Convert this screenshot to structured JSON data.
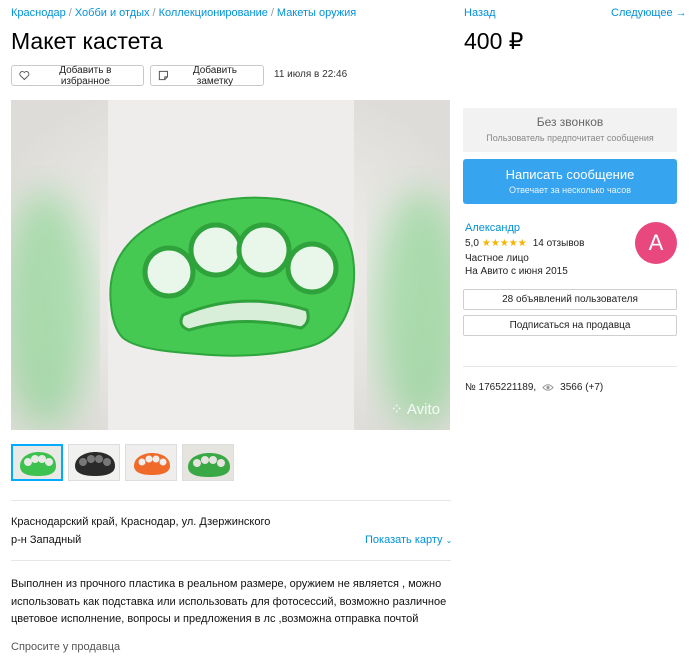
{
  "breadcrumb": {
    "items": [
      "Краснодар",
      "Хобби и отдых",
      "Коллекционирование",
      "Макеты оружия"
    ],
    "separator": "/"
  },
  "listing": {
    "title": "Макет кастета",
    "price": "400 ₽",
    "date": "11 июля в 22:46",
    "id_text": "№ 1765221189,",
    "views": "3566 (+7)"
  },
  "nav": {
    "back": "Назад",
    "next": "Следующее →"
  },
  "actions": {
    "favorite_label": "Добавить в избранное",
    "note_label": "Добавить заметку",
    "favorite_icon": "heart-icon",
    "note_icon": "note-icon"
  },
  "gallery": {
    "watermark": "Avito",
    "thumbnails": [
      {
        "color": "#3ec24f",
        "active": true
      },
      {
        "color": "#2a2a2a",
        "active": false
      },
      {
        "color": "#f06a2a",
        "active": false
      },
      {
        "color": "#3aa845",
        "active": false
      }
    ],
    "main_color": "#45c952"
  },
  "location": {
    "address": "Краснодарский край, Краснодар, ул. Дзержинского",
    "district": "р-н Западный",
    "show_map": "Показать карту"
  },
  "description": "Выполнен из прочного пластика в реальном размере, оружием не является , можно использовать как подставка или использовать для фотосессий, возможно различное цветовое исполнение, вопросы и предложения в лс ,возможна отправка почтой",
  "ask_seller": "Спросите у продавца",
  "contact": {
    "no_calls_title": "Без звонков",
    "no_calls_sub": "Пользователь предпочитает сообщения",
    "write_title": "Написать сообщение",
    "write_sub": "Отвечает за несколько часов",
    "accent": "#37a4ef"
  },
  "seller": {
    "name": "Александр",
    "rating": "5,0",
    "stars": "★★★★★",
    "reviews": "14 отзывов",
    "type": "Частное лицо",
    "since": "На Авито с июня 2015",
    "avatar_letter": "А",
    "avatar_color": "#e8487d",
    "ads_button": "28 объявлений пользователя",
    "subscribe_button": "Подписаться на продавца"
  }
}
